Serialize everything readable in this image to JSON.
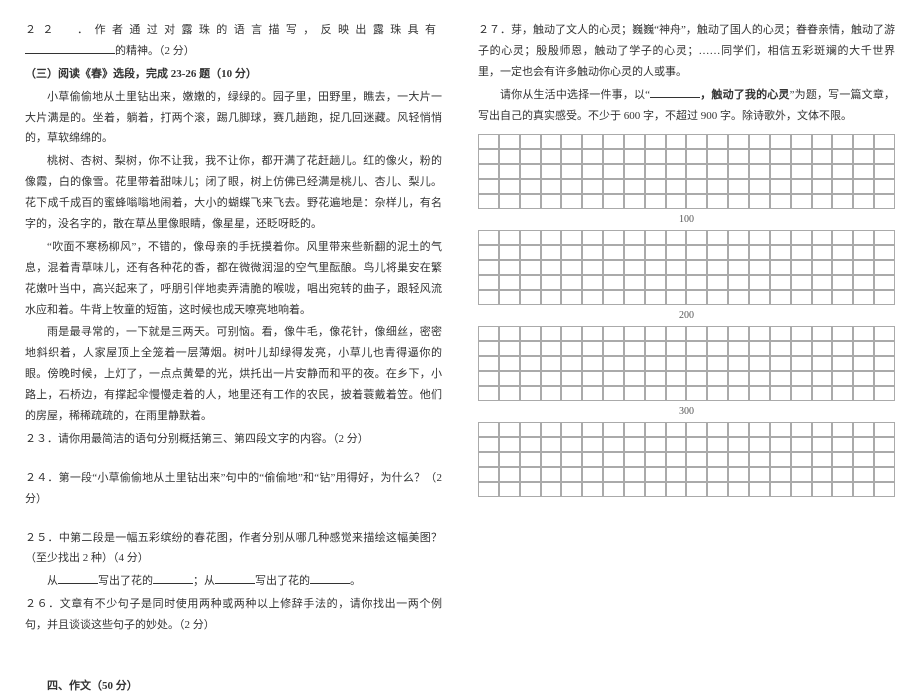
{
  "left": {
    "q22_prefix": "２２　．作者通过对露珠的语言描写，反映出露珠具有",
    "q22_suffix": "的精神。（2 分）",
    "section3_title": "（三）阅读《春》选段，完成 23-26 题（10 分）",
    "p1": "小草偷偷地从土里钻出来，嫩嫩的，绿绿的。园子里，田野里，瞧去，一大片一大片满是的。坐着，躺着，打两个滚，踢几脚球，赛几趟跑，捉几回迷藏。风轻悄悄的，草软绵绵的。",
    "p2": "桃树、杏树、梨树，你不让我，我不让你，都开满了花赶趟儿。红的像火，粉的像霞，白的像雪。花里带着甜味儿；闭了眼，树上仿佛已经满是桃儿、杏儿、梨儿。花下成千成百的蜜蜂嗡嗡地闹着，大小的蝴蝶飞来飞去。野花遍地是：杂样儿，有名字的，没名字的，散在草丛里像眼睛，像星星，还眨呀眨的。",
    "p3": "“吹面不寒杨柳风”，不错的，像母亲的手抚摸着你。风里带来些新翻的泥土的气息，混着青草味儿，还有各种花的香，都在微微润湿的空气里酝酿。鸟儿将巢安在繁花嫩叶当中，高兴起来了，呼朋引伴地卖弄清脆的喉咙，唱出宛转的曲子，跟轻风流水应和着。牛背上牧童的短笛，这时候也成天嘹亮地响着。",
    "p4": "雨是最寻常的，一下就是三两天。可别恼。看，像牛毛，像花针，像细丝，密密地斜织着，人家屋顶上全笼着一层薄烟。树叶儿却绿得发亮，小草儿也青得逼你的眼。傍晚时候，上灯了，一点点黄晕的光，烘托出一片安静而和平的夜。在乡下，小路上，石桥边，有撑起伞慢慢走着的人，地里还有工作的农民，披着蓑戴着笠。他们的房屋，稀稀疏疏的，在雨里静默着。",
    "q23": "２３．请你用最简洁的语句分别概括第三、第四段文字的内容。（2 分）",
    "q24": "２４．第一段“小草偷偷地从土里钻出来”句中的“偷偷地”和“钻”用得好，为什么？（2 分）",
    "q25": "２５．中第二段是一幅五彩缤纷的春花图，作者分别从哪几种感觉来描绘这幅美图？（至少找出 2 种）（4 分）",
    "q25_fill_a1": "从",
    "q25_fill_a2": "写出了花的",
    "q25_fill_b1": "；从",
    "q25_fill_b2": "写出了花的",
    "q25_fill_end": "。",
    "q26": "２６．文章有不少句子是同时使用两种或两种以上修辞手法的，请你找出一两个例句，并且谈谈这些句子的妙处。（2 分）",
    "section4_title": "四、作文（50 分）"
  },
  "right": {
    "q27_p1": "２７．芽，触动了文人的心灵；巍巍“神舟”，触动了国人的心灵；眷眷亲情，触动了游子的心灵；殷殷师恩，触动了学子的心灵；……同学们，相信五彩斑斓的大千世界里，一定也会有许多触动你心灵的人或事。",
    "q27_p2a": "请你从生活中选择一件事，以“",
    "q27_p2_bold": "，触动了我的心灵",
    "q27_p2b": "”为题，写一篇文章，写出自己的真实感受。不少于 600 字，不超过 900 字。除诗歌外，文体不限。",
    "markers": [
      "100",
      "200",
      "300"
    ]
  }
}
